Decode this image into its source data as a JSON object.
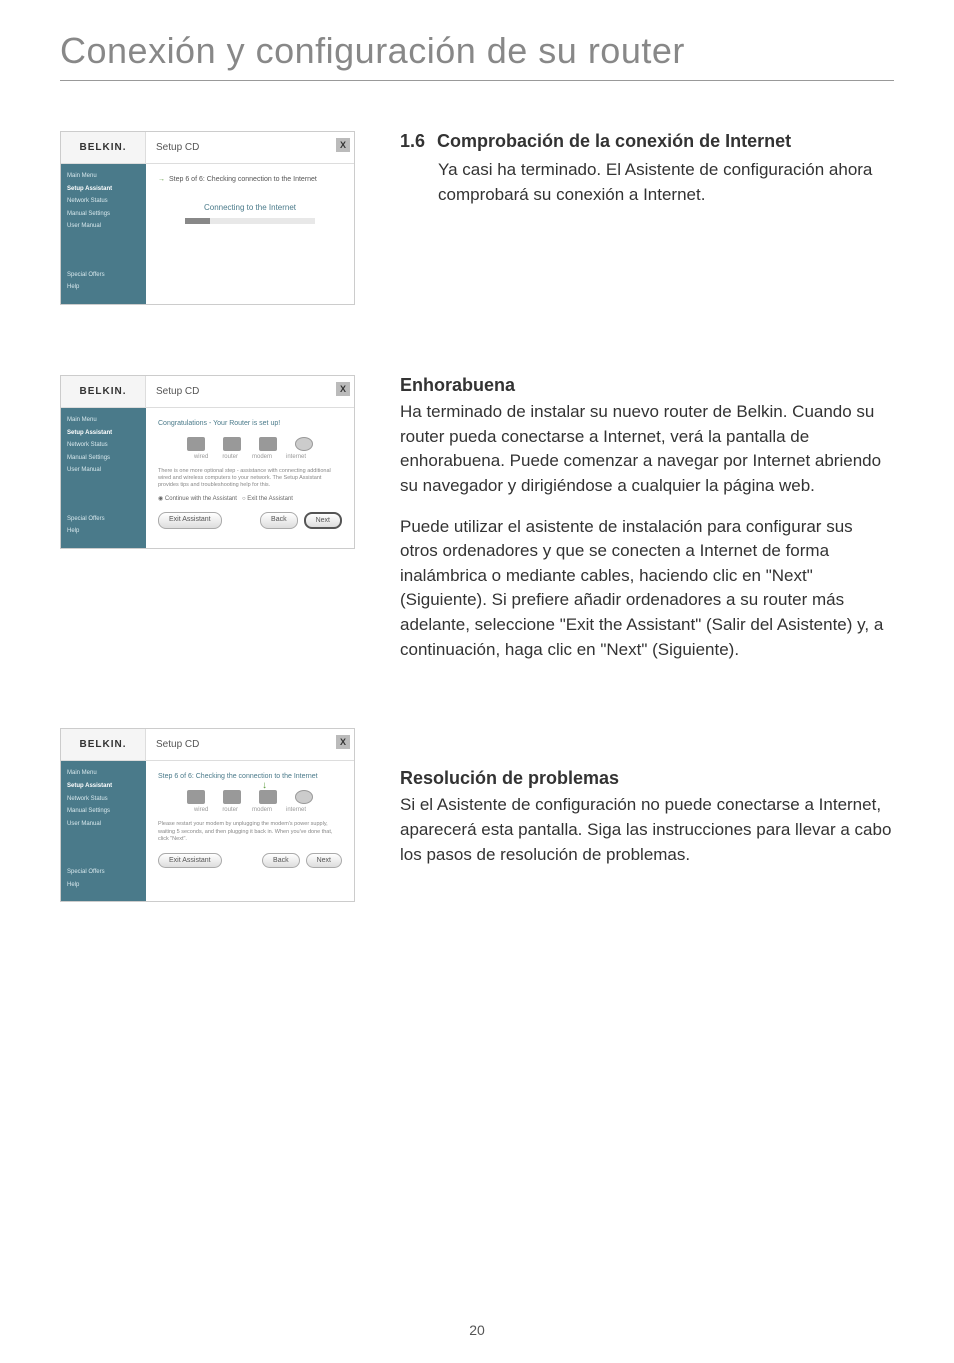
{
  "page": {
    "title": "Conexión y configuración de su router",
    "number": "20"
  },
  "belkin": {
    "logo": "BELKIN.",
    "setup_cd": "Setup CD",
    "close": "X",
    "sidebar": {
      "main_menu": "Main Menu",
      "setup_assistant": "Setup Assistant",
      "network_status": "Network Status",
      "manual_settings": "Manual Settings",
      "user_manual": "User Manual",
      "special_offers": "Special Offers",
      "help": "Help"
    }
  },
  "screenshot1": {
    "step_text": "Step 6 of 6: Checking connection to the Internet",
    "connecting": "Connecting to the Internet"
  },
  "screenshot2": {
    "congrats": "Congratulations - Your Router is set up!",
    "labels": {
      "wired": "wired",
      "router": "router",
      "modem": "modem",
      "internet": "internet"
    },
    "tiny": "There is one more optional step - assistance with connecting additional wired and wireless computers to your network. The Setup Assistant provides tips and troubleshooting help for this.",
    "radio1": "Continue with the Assistant",
    "radio2": "Exit the Assistant",
    "btn_exit": "Exit Assistant",
    "btn_back": "Back",
    "btn_next": "Next"
  },
  "screenshot3": {
    "step_text": "Step 6 of 6: Checking the connection to the Internet",
    "labels": {
      "wired": "wired",
      "router": "router",
      "modem": "modem",
      "internet": "internet"
    },
    "tiny": "Please restart your modem by unplugging the modem's power supply, waiting 5 seconds, and then plugging it back in. When you've done that, click \"Next\".",
    "btn_exit": "Exit Assistant",
    "btn_back": "Back",
    "btn_next": "Next"
  },
  "section16": {
    "num": "1.6",
    "title": "Comprobación de la conexión de Internet",
    "body": "Ya casi ha terminado. El Asistente de configuración ahora comprobará su conexión a Internet."
  },
  "section_enhorabuena": {
    "title": "Enhorabuena",
    "p1": "Ha terminado de instalar su nuevo router de Belkin. Cuando su router pueda conectarse a Internet, verá la pantalla de enhorabuena. Puede comenzar a navegar por Internet abriendo su navegador y dirigiéndose a cualquier la página web.",
    "p2": "Puede utilizar el asistente de instalación para configurar sus otros ordenadores y que se conecten a Internet de forma inalámbrica o mediante cables, haciendo clic en \"Next\" (Siguiente). Si prefiere añadir ordenadores a su router más adelante, seleccione \"Exit the Assistant\" (Salir del Asistente) y, a continuación, haga clic en \"Next\" (Siguiente)."
  },
  "section_resolucion": {
    "title": "Resolución de problemas",
    "body": "Si el Asistente de configuración no puede conectarse a Internet, aparecerá esta pantalla. Siga las instrucciones para llevar a cabo los pasos de resolución de problemas."
  }
}
